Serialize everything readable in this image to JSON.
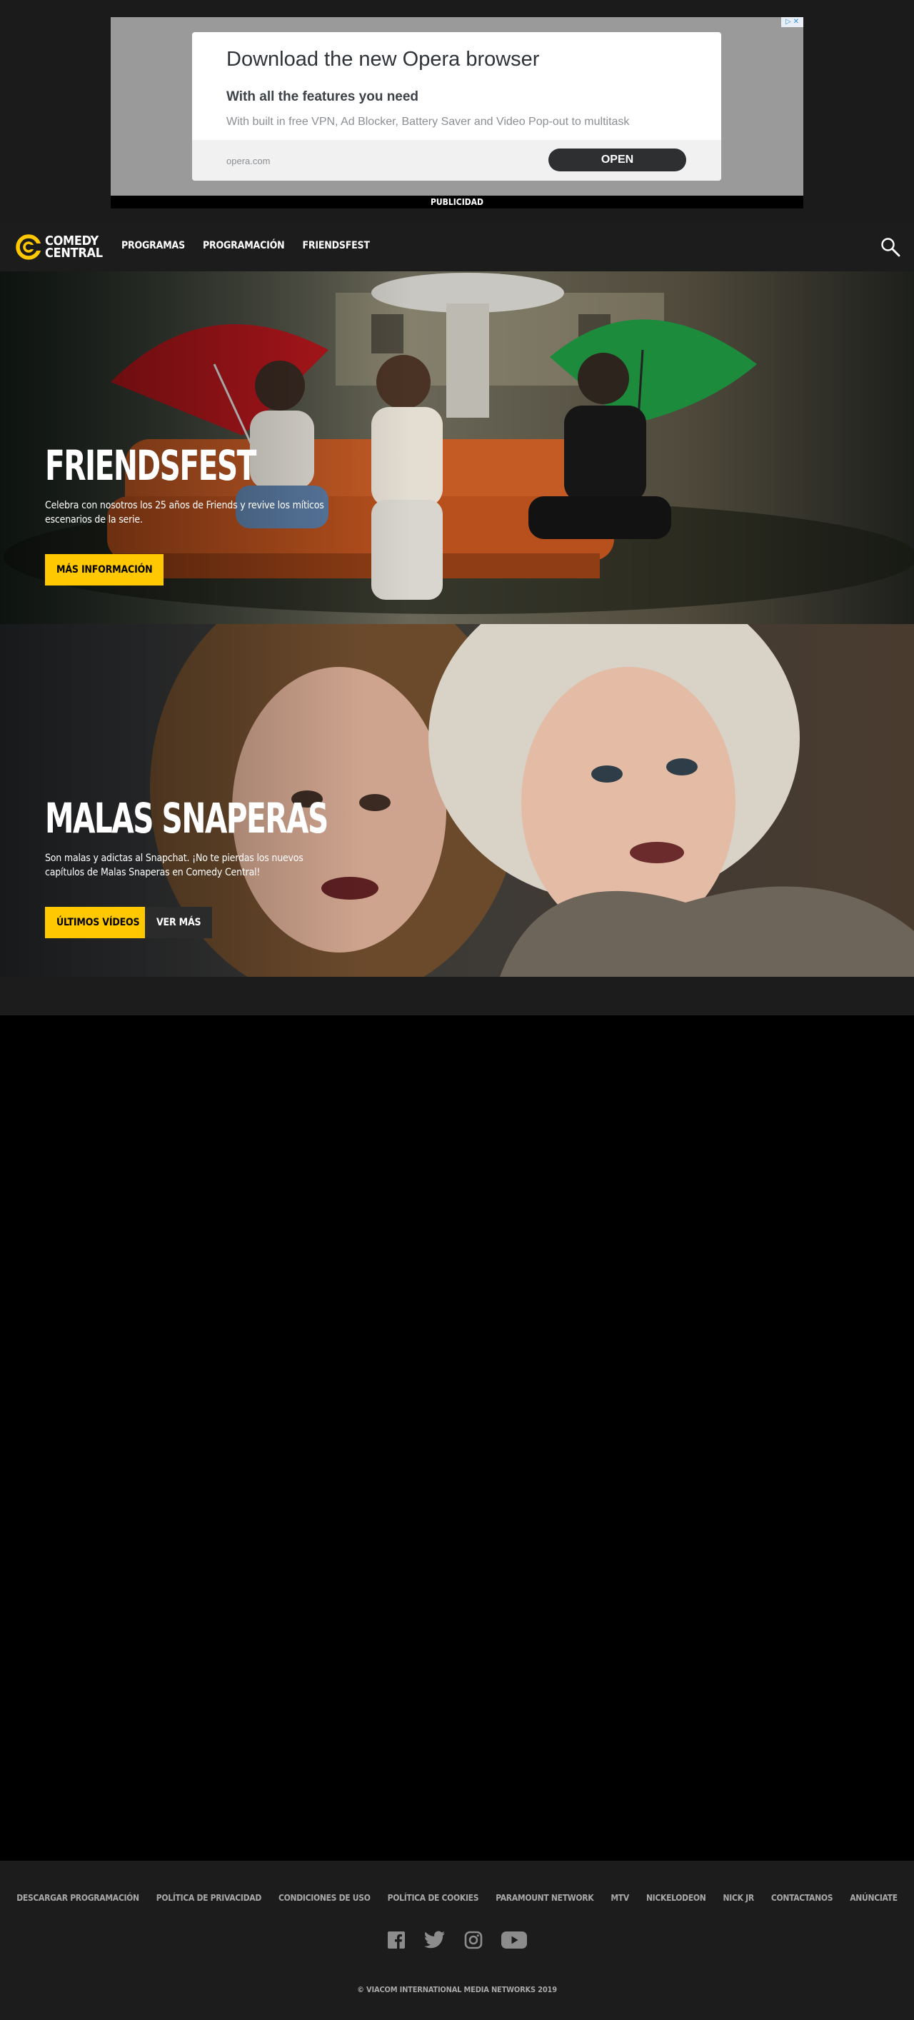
{
  "ad": {
    "title": "Download the new Opera browser",
    "subtitle": "With all the features you need",
    "description": "With built in free VPN, Ad Blocker, Battery Saver and Video Pop-out to multitask",
    "url": "opera.com",
    "cta": "OPEN",
    "label": "PUBLICIDAD",
    "badge_icons": [
      "adchoices-icon",
      "close-icon"
    ]
  },
  "header": {
    "logo_line1": "COMEDY",
    "logo_line2": "CENTRAL",
    "nav": [
      "PROGRAMAS",
      "PROGRAMACIÓN",
      "FRIENDSFEST"
    ],
    "search_icon": "search-icon"
  },
  "heroes": [
    {
      "title": "FRIENDSFEST",
      "description": "Celebra con nosotros los 25 años de Friends y revive los míticos escenarios de la serie.",
      "primary_button": "MÁS INFORMACIÓN"
    },
    {
      "title": "MALAS SNAPERAS",
      "description": "Son malas y adictas al Snapchat. ¡No te pierdas los nuevos capítulos de Malas Snaperas en Comedy Central!",
      "primary_button": "ÚLTIMOS VÍDEOS",
      "secondary_button": "VER MÁS"
    }
  ],
  "footer": {
    "links": [
      "DESCARGAR PROGRAMACIÓN",
      "POLÍTICA DE PRIVACIDAD",
      "CONDICIONES DE USO",
      "POLÍTICA DE COOKIES",
      "PARAMOUNT NETWORK",
      "MTV",
      "NICKELODEON",
      "NICK JR",
      "CONTACTANOS",
      "ANÚNCIATE"
    ],
    "social": [
      "facebook-icon",
      "twitter-icon",
      "instagram-icon",
      "youtube-icon"
    ],
    "copyright": "© VIACOM INTERNATIONAL MEDIA NETWORKS 2019"
  },
  "colors": {
    "accent": "#ffc800",
    "header_bg": "#1c1c1c",
    "page_bg": "#000000"
  }
}
